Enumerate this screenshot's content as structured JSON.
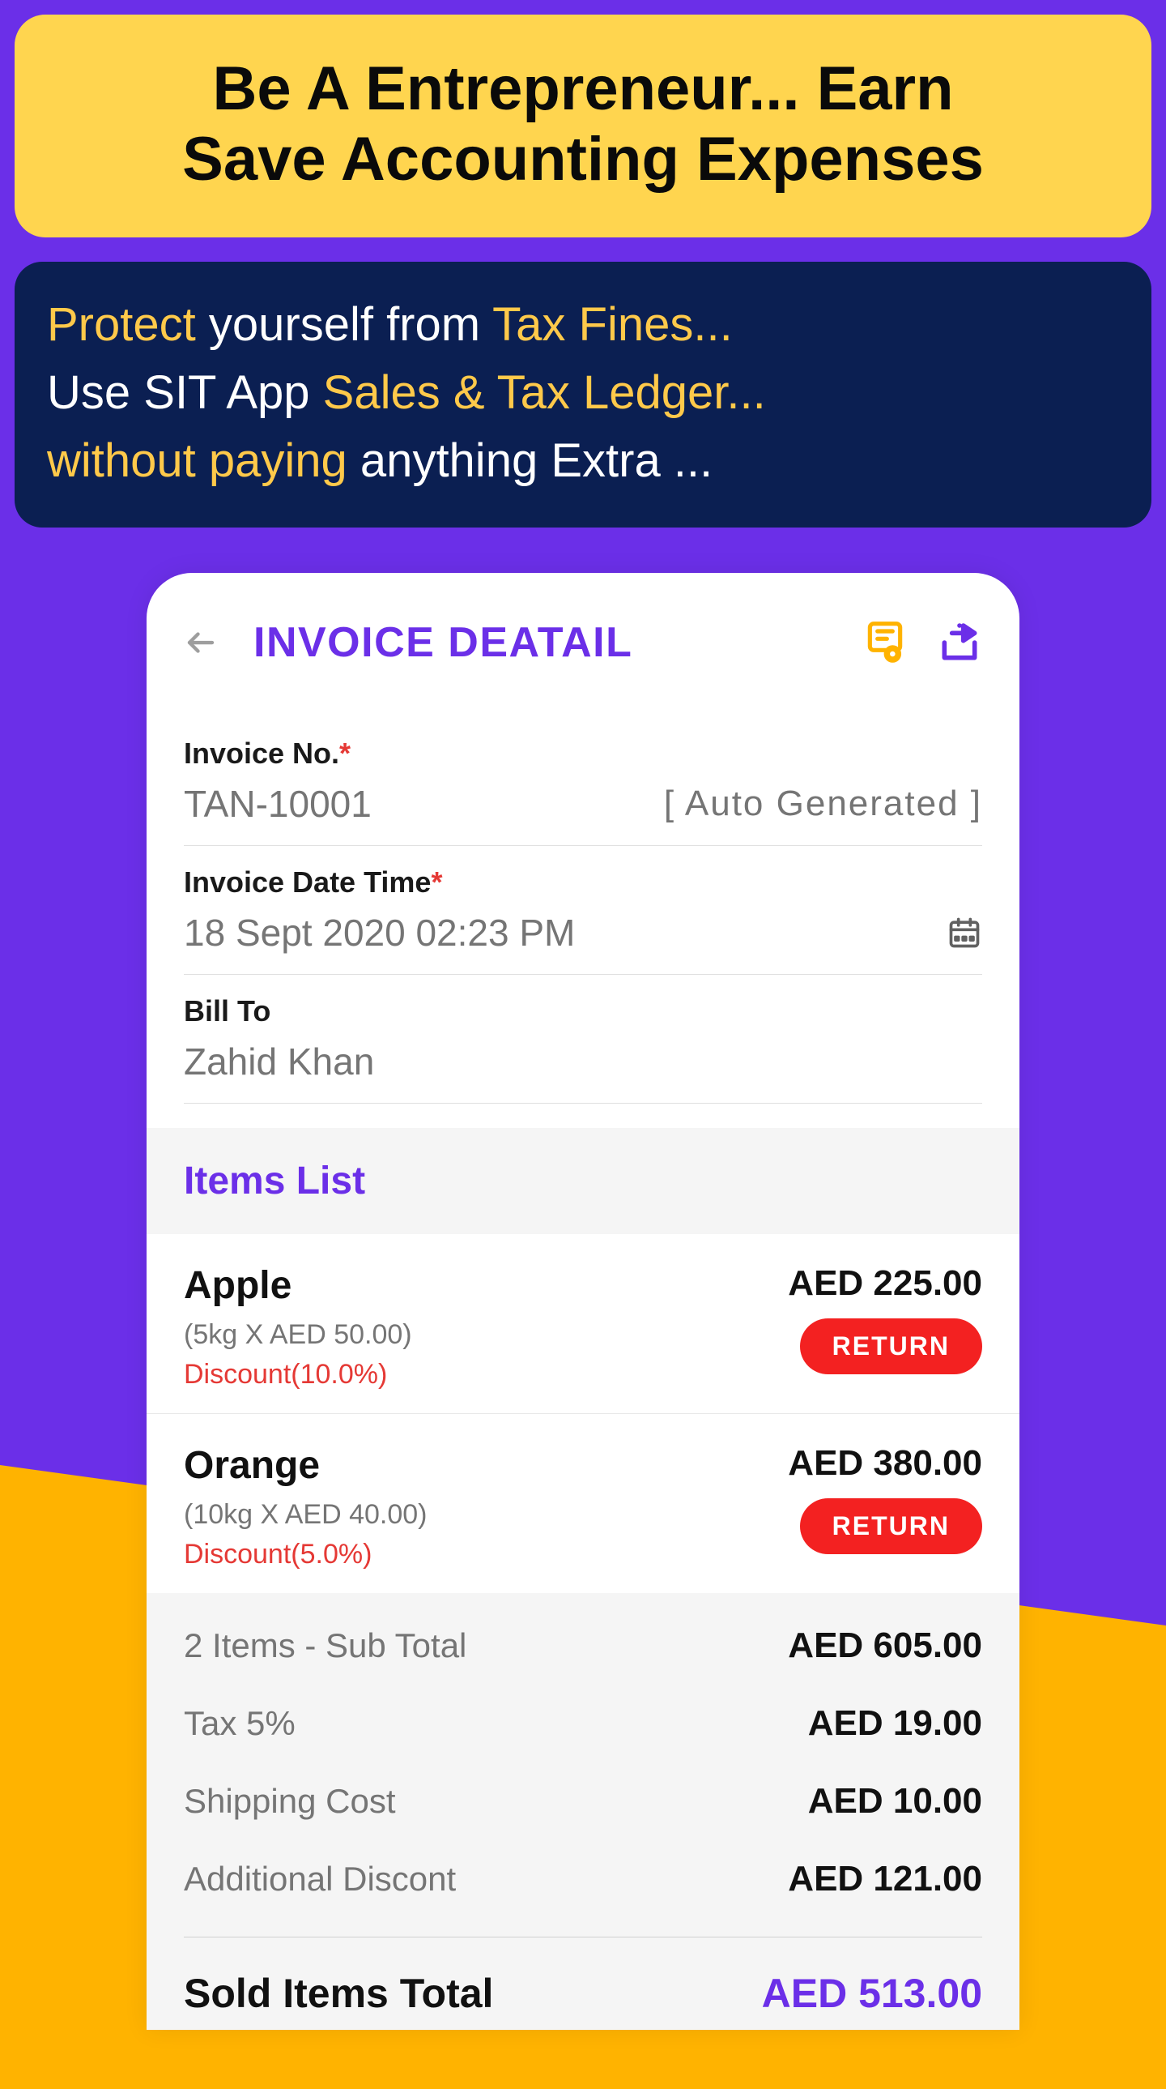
{
  "banner": {
    "yellow": {
      "line1": "Be A Entrepreneur... Earn",
      "line2": "Save Accounting Expenses"
    },
    "navy": {
      "p1_a": "Protect",
      "p1_b": " yourself from ",
      "p1_c": "Tax Fines...",
      "p2_a": "Use SIT App ",
      "p2_b": "Sales & Tax Ledger...",
      "p3_a": "without paying",
      "p3_b": " anything Extra ..."
    }
  },
  "app": {
    "title": "INVOICE DEATAIL"
  },
  "invoiceNo": {
    "label": "Invoice No.",
    "value": "TAN-10001",
    "auto": "[ Auto Generated ]"
  },
  "invoiceDate": {
    "label": "Invoice Date Time",
    "value": "18 Sept 2020 02:23 PM"
  },
  "billTo": {
    "label": "Bill To",
    "value": "Zahid Khan"
  },
  "itemsHeader": "Items List",
  "items": [
    {
      "name": "Apple",
      "sub": "(5kg X AED 50.00)",
      "discount": "Discount(10.0%)",
      "price": "AED 225.00",
      "action": "RETURN"
    },
    {
      "name": "Orange",
      "sub": "(10kg X AED 40.00)",
      "discount": "Discount(5.0%)",
      "price": "AED 380.00",
      "action": "RETURN"
    }
  ],
  "totals": [
    {
      "label": "2 Items - Sub Total",
      "value": "AED 605.00"
    },
    {
      "label": "Tax 5%",
      "value": "AED 19.00"
    },
    {
      "label": "Shipping Cost",
      "value": "AED 10.00"
    },
    {
      "label": "Additional Discont",
      "value": "AED 121.00"
    }
  ],
  "grand": {
    "label": "Sold Items Total",
    "value": "AED 513.00"
  }
}
